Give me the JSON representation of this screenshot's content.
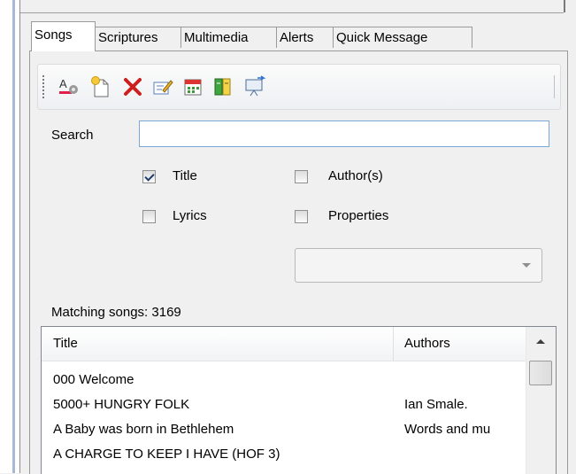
{
  "tabs": [
    {
      "label": "Songs",
      "active": true
    },
    {
      "label": "Scriptures",
      "active": false
    },
    {
      "label": "Multimedia",
      "active": false
    },
    {
      "label": "Alerts",
      "active": false
    },
    {
      "label": "Quick Message",
      "active": false
    }
  ],
  "toolbar": {
    "icons": [
      "font-settings-icon",
      "new-song-icon",
      "delete-icon",
      "edit-icon",
      "schedule-icon",
      "book-icon",
      "projector-icon"
    ]
  },
  "search": {
    "label": "Search",
    "value": "",
    "placeholder": ""
  },
  "options": {
    "title": {
      "label": "Title",
      "checked": true
    },
    "authors": {
      "label": "Author(s)",
      "checked": false
    },
    "lyrics": {
      "label": "Lyrics",
      "checked": false
    },
    "properties": {
      "label": "Properties",
      "checked": false
    }
  },
  "properties_select": {
    "value": ""
  },
  "matching": "Matching songs: 3169",
  "list": {
    "columns": [
      "Title",
      "Authors"
    ],
    "rows": [
      {
        "title": "000 Welcome",
        "authors": ""
      },
      {
        "title": "5000+ HUNGRY FOLK",
        "authors": "Ian Smale."
      },
      {
        "title": "A Baby was born in Bethlehem",
        "authors": "Words and mu"
      },
      {
        "title": "A CHARGE TO KEEP I HAVE (HOF 3)",
        "authors": ""
      }
    ]
  },
  "colors": {
    "accent_border": "#7aa7d8",
    "delete_red": "#cc1f1f"
  }
}
